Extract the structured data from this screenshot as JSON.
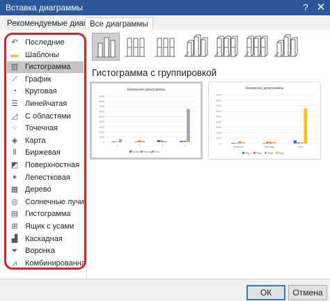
{
  "window": {
    "title": "Вставка диаграммы",
    "help": "?",
    "close": "✕"
  },
  "tabs": [
    {
      "label": "Рекомендуемые диаграммы"
    },
    {
      "label": "Все диаграммы"
    }
  ],
  "sidebar": {
    "items": [
      {
        "label": "Последние",
        "icon": "undo-arrow-icon"
      },
      {
        "label": "Шаблоны",
        "icon": "folder-icon"
      },
      {
        "label": "Гистограмма",
        "icon": "column-chart-icon",
        "selected": true
      },
      {
        "label": "График",
        "icon": "line-chart-icon"
      },
      {
        "label": "Круговая",
        "icon": "pie-chart-icon"
      },
      {
        "label": "Линейчатая",
        "icon": "bar-chart-icon"
      },
      {
        "label": "С областями",
        "icon": "area-chart-icon"
      },
      {
        "label": "Точечная",
        "icon": "scatter-chart-icon"
      },
      {
        "label": "Карта",
        "icon": "map-icon"
      },
      {
        "label": "Биржевая",
        "icon": "stock-chart-icon"
      },
      {
        "label": "Поверхностная",
        "icon": "surface-chart-icon"
      },
      {
        "label": "Лепестковая",
        "icon": "radar-chart-icon"
      },
      {
        "label": "Дерево",
        "icon": "treemap-icon"
      },
      {
        "label": "Солнечные лучи",
        "icon": "sunburst-icon"
      },
      {
        "label": "Гистограмма",
        "icon": "histogram-icon"
      },
      {
        "label": "Ящик с усами",
        "icon": "box-whisker-icon"
      },
      {
        "label": "Каскадная",
        "icon": "waterfall-icon"
      },
      {
        "label": "Воронка",
        "icon": "funnel-icon"
      },
      {
        "label": "Комбинированная",
        "icon": "combo-chart-icon"
      }
    ]
  },
  "main": {
    "subtitle": "Гистограмма с группировкой",
    "variants": [
      {
        "icon": "clustered-column-icon",
        "selected": true
      },
      {
        "icon": "stacked-column-icon"
      },
      {
        "icon": "100-stacked-column-icon"
      },
      {
        "icon": "3d-clustered-column-icon"
      },
      {
        "icon": "3d-stacked-column-icon"
      },
      {
        "icon": "3d-100-stacked-column-icon"
      },
      {
        "icon": "3d-column-icon"
      }
    ]
  },
  "previews": [
    {
      "title": "Название диаграммы",
      "yticks": [
        "9000",
        "8000",
        "7000",
        "6000",
        "5000",
        "4000",
        "3000",
        "2000",
        "1000",
        "0"
      ],
      "categories": [
        "1",
        "2",
        "3",
        "4"
      ],
      "series": [
        {
          "name": "Прибыль",
          "color": "#4472c4",
          "values": [
            120,
            90,
            400,
            250
          ]
        },
        {
          "name": "Расходы",
          "color": "#ed7d31",
          "values": [
            80,
            350,
            300,
            280
          ]
        },
        {
          "name": "Итог",
          "color": "#a5a5a5",
          "values": [
            600,
            220,
            180,
            6500
          ]
        }
      ],
      "legend": [
        "Прибыль",
        "Расходы",
        "Итог"
      ]
    },
    {
      "title": "Название диаграммы",
      "yticks": [
        "9000",
        "8000",
        "7000",
        "6000",
        "5000",
        "4000",
        "3000",
        "2000",
        "1000",
        "0"
      ],
      "categories": [
        "Прибыль",
        "Расходы",
        "Итог"
      ],
      "series": [
        {
          "name": "Ряд1",
          "color": "#4472c4",
          "values": [
            120,
            80,
            600
          ]
        },
        {
          "name": "Ряд2",
          "color": "#ed7d31",
          "values": [
            90,
            350,
            220
          ]
        },
        {
          "name": "Ряд3",
          "color": "#a5a5a5",
          "values": [
            400,
            300,
            180
          ]
        },
        {
          "name": "Ряд4",
          "color": "#ffc000",
          "values": [
            250,
            280,
            6500
          ]
        }
      ],
      "legend": [
        "Ряд1",
        "Ряд2",
        "Ряд3",
        "Ряд4"
      ]
    }
  ],
  "footer": {
    "ok": "ОК",
    "cancel": "Отмена"
  }
}
